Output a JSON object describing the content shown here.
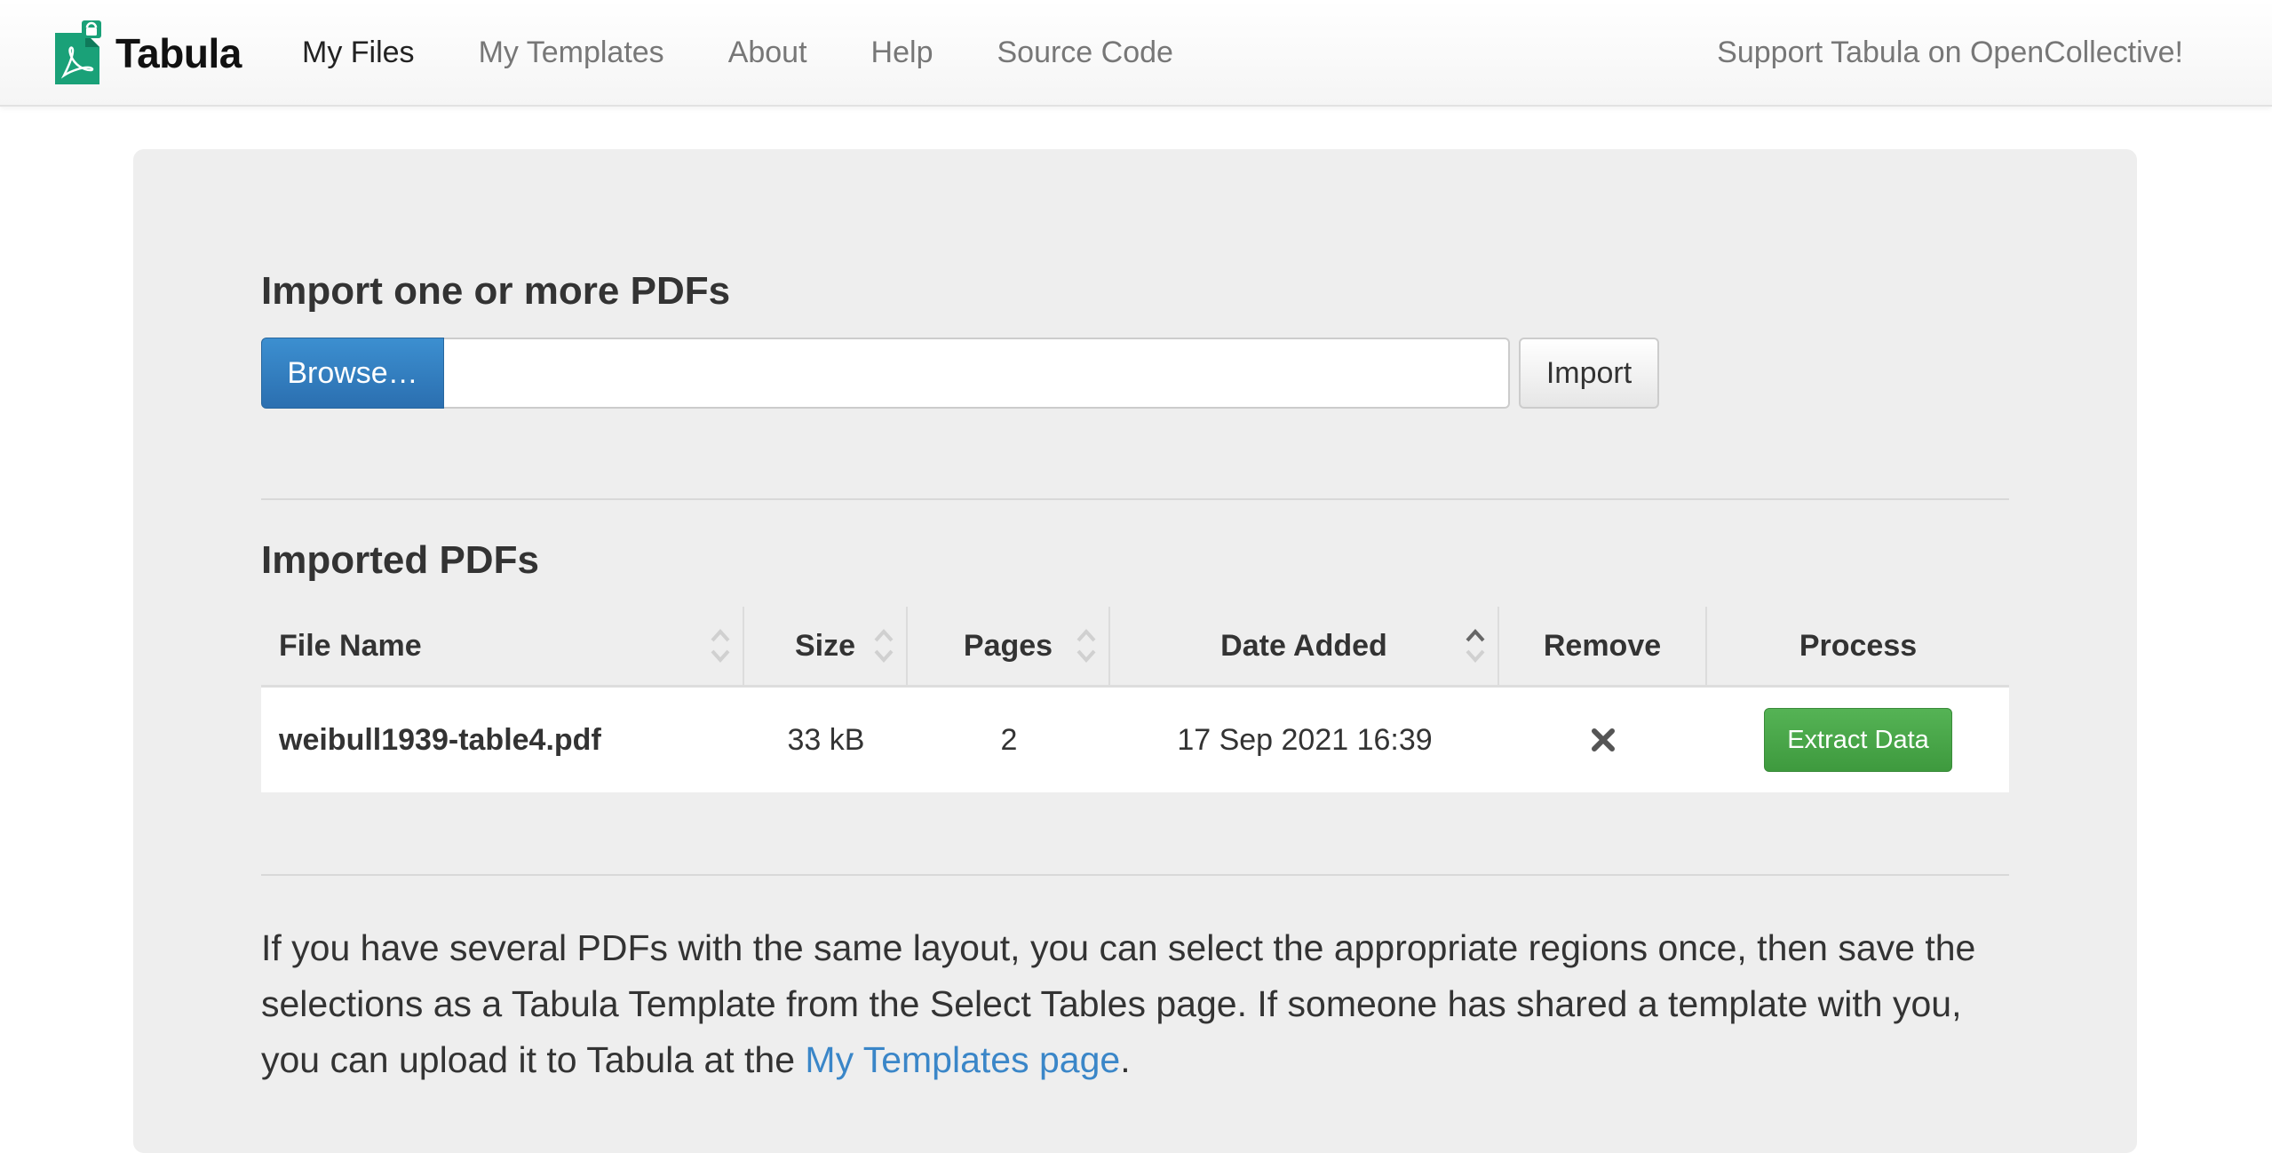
{
  "navbar": {
    "brand": "Tabula",
    "links": [
      {
        "label": "My Files",
        "active": true
      },
      {
        "label": "My Templates",
        "active": false
      },
      {
        "label": "About",
        "active": false
      },
      {
        "label": "Help",
        "active": false
      },
      {
        "label": "Source Code",
        "active": false
      }
    ],
    "support_link": "Support Tabula on OpenCollective!"
  },
  "import": {
    "title": "Import one or more PDFs",
    "browse_label": "Browse…",
    "file_value": "",
    "import_label": "Import"
  },
  "imported": {
    "title": "Imported PDFs",
    "columns": [
      "File Name",
      "Size",
      "Pages",
      "Date Added",
      "Remove",
      "Process"
    ],
    "rows": [
      {
        "file_name": "weibull1939-table4.pdf",
        "size": "33 kB",
        "pages": "2",
        "date_added": "17 Sep 2021 16:39",
        "process_label": "Extract Data"
      }
    ]
  },
  "help": {
    "text_before": "If you have several PDFs with the same layout, you can select the appropriate regions once, then save the selections as a Tabula Template from the Select Tables page. If someone has shared a template with you, you can upload it to Tabula at the ",
    "link_text": "My Templates page",
    "text_after": "."
  },
  "colors": {
    "brand_green": "#1aa178",
    "primary_blue": "#2b6fb0",
    "success_green": "#43a047",
    "link_blue": "#3a86c8",
    "panel_bg": "#eeeeee"
  },
  "icons": {
    "logo": "tabula-pdf-logo-icon",
    "sort": "sort-arrows-icon",
    "remove": "remove-x-icon"
  }
}
